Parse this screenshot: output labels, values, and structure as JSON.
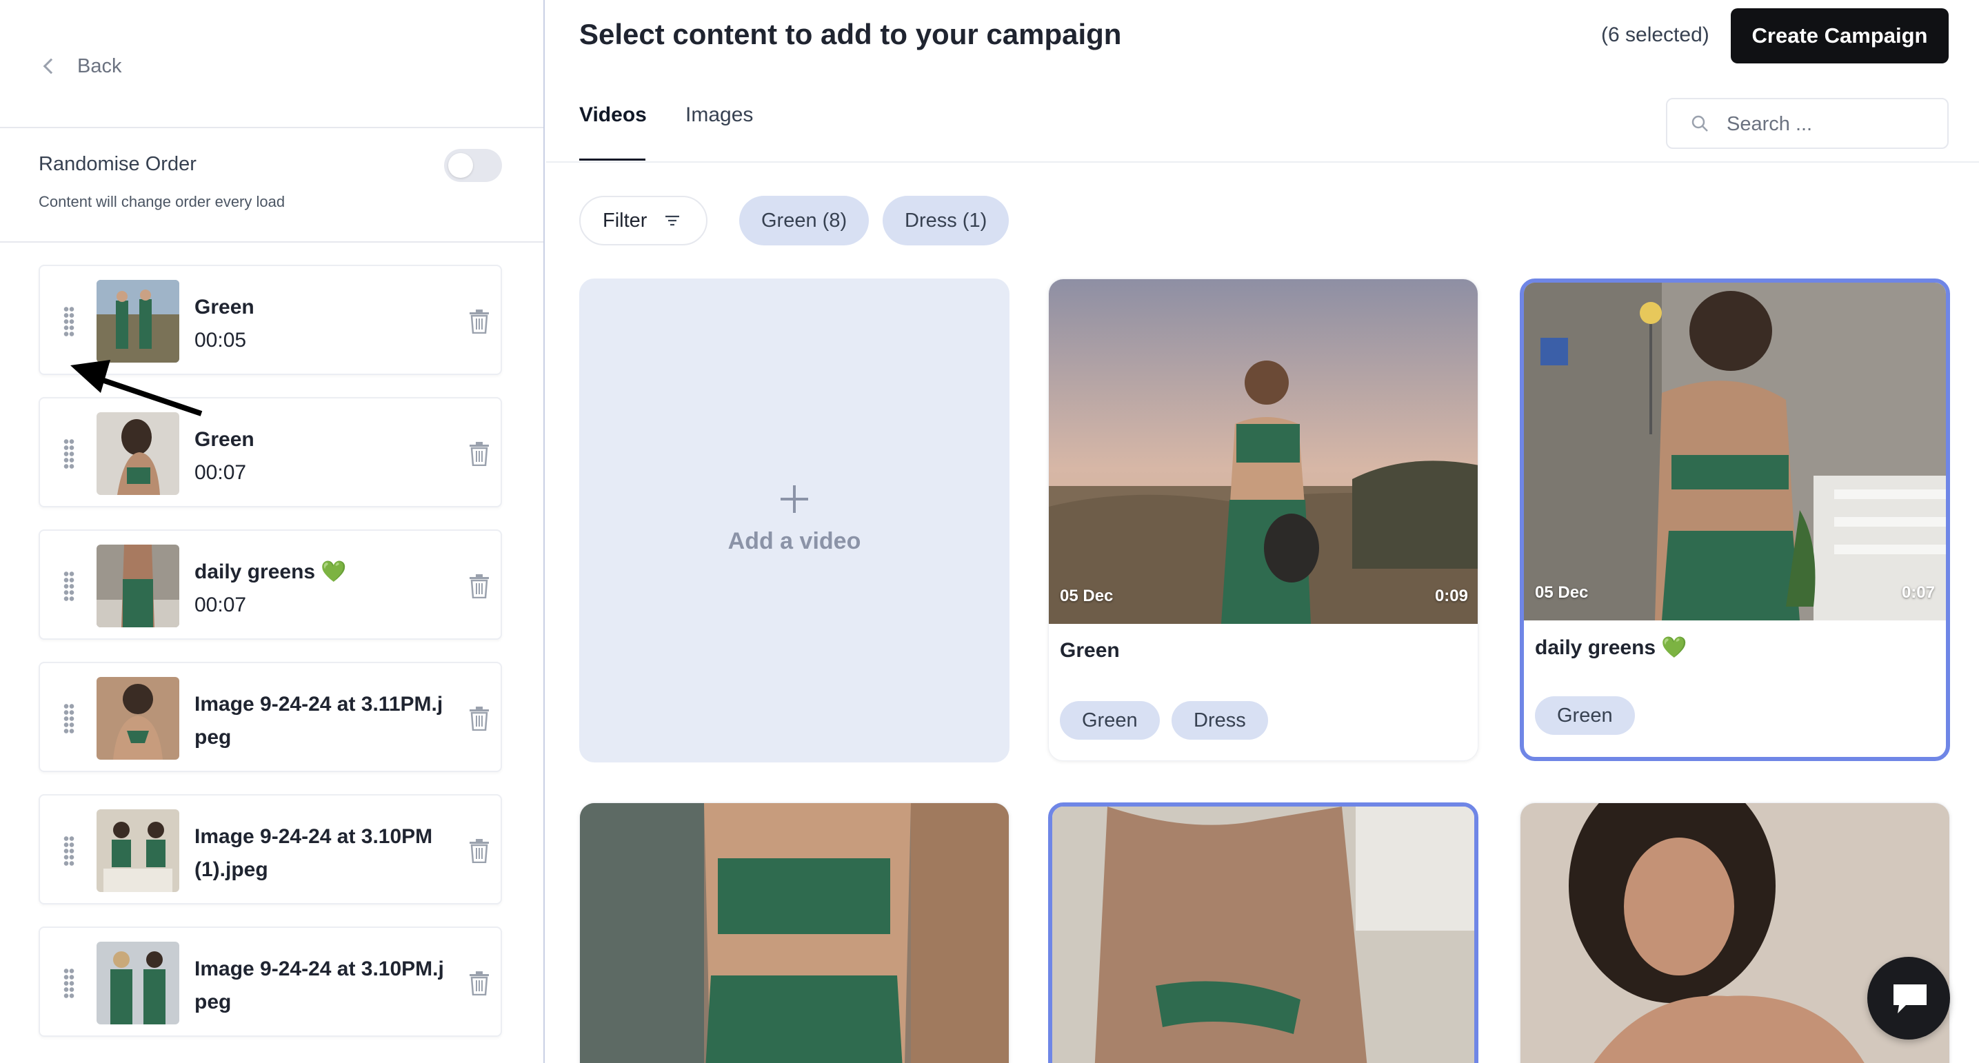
{
  "sidebar": {
    "back_label": "Back",
    "randomise": {
      "title": "Randomise Order",
      "description": "Content will change order every load",
      "enabled": false
    },
    "items": [
      {
        "title": "Green",
        "subtitle": "00:05"
      },
      {
        "title": "Green",
        "subtitle": "00:07"
      },
      {
        "title": "daily greens 💚",
        "subtitle": "00:07"
      },
      {
        "title": "Image 9-24-24 at 3.11PM.jpeg",
        "subtitle": ""
      },
      {
        "title": "Image 9-24-24 at 3.10PM (1).jpeg",
        "subtitle": ""
      },
      {
        "title": "Image 9-24-24 at 3.10PM.jpeg",
        "subtitle": ""
      }
    ]
  },
  "header": {
    "title": "Select content to add to your campaign",
    "selected_count": "(6 selected)",
    "create_button": "Create Campaign"
  },
  "tabs": [
    {
      "label": "Videos",
      "active": true
    },
    {
      "label": "Images",
      "active": false
    }
  ],
  "search": {
    "placeholder": "Search ...",
    "value": ""
  },
  "filter": {
    "label": "Filter",
    "chips": [
      {
        "label": "Green (8)"
      },
      {
        "label": "Dress (1)"
      }
    ]
  },
  "grid": {
    "add_label": "Add a video",
    "cards": [
      {
        "title": "Green",
        "date": "05 Dec",
        "duration": "0:09",
        "tags": [
          "Green",
          "Dress"
        ],
        "selected": false
      },
      {
        "title": "daily greens 💚",
        "date": "05 Dec",
        "duration": "0:07",
        "tags": [
          "Green"
        ],
        "selected": true
      }
    ]
  },
  "colors": {
    "accent_selected": "#6f86e6",
    "chip_bg": "#d8e0f3",
    "primary_button": "#101114"
  }
}
